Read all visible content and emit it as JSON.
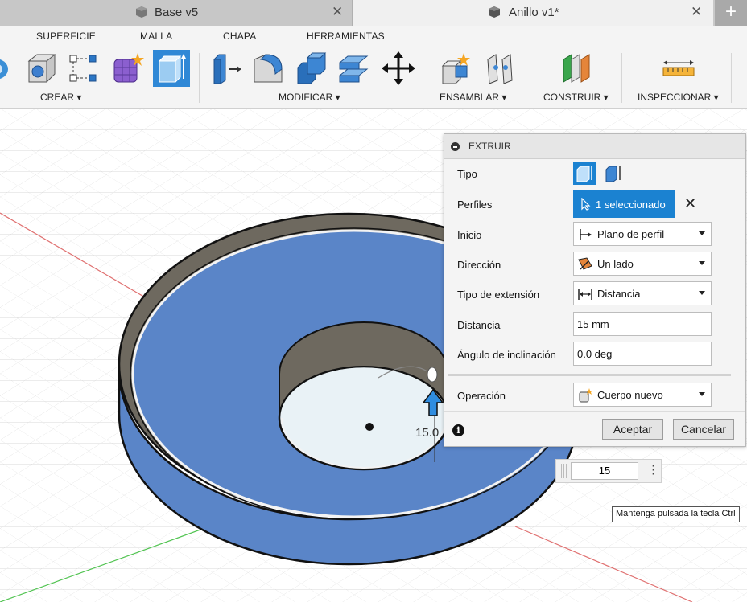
{
  "tabs": [
    {
      "label": "Base v5",
      "icon": "document-cube-icon",
      "active": false
    },
    {
      "label": "Anillo v1*",
      "icon": "document-cube-icon",
      "active": true
    }
  ],
  "toolbar": {
    "subtabs": [
      "SUPERFICIE",
      "MALLA",
      "CHAPA",
      "HERRAMIENTAS"
    ],
    "groups": [
      {
        "label": "CREAR ▾",
        "tools": [
          "revolve-icon",
          "hole-icon",
          "sketch-pattern-icon",
          "form-icon",
          "extrude-icon"
        ]
      },
      {
        "label": "MODIFICAR ▾",
        "tools": [
          "press-pull-icon",
          "fillet-icon",
          "combine-icon",
          "shell-icon",
          "move-icon"
        ]
      },
      {
        "label": "ENSAMBLAR ▾",
        "tools": [
          "new-component-icon",
          "joint-icon"
        ]
      },
      {
        "label": "CONSTRUIR ▾",
        "tools": [
          "offset-plane-icon"
        ]
      },
      {
        "label": "INSPECCIONAR ▾",
        "tools": [
          "measure-icon"
        ]
      }
    ]
  },
  "panel": {
    "title": "EXTRUIR",
    "rows": {
      "tipo": "Tipo",
      "perfiles": "Perfiles",
      "inicio": "Inicio",
      "direccion": "Dirección",
      "tipo_extension": "Tipo de extensión",
      "distancia": "Distancia",
      "angulo": "Ángulo de inclinación",
      "operacion": "Operación"
    },
    "values": {
      "perfiles": "1 seleccionado",
      "inicio": "Plano de perfil",
      "direccion": "Un lado",
      "tipo_extension": "Distancia",
      "distancia": "15 mm",
      "angulo": "0.0 deg",
      "operacion": "Cuerpo nuevo"
    },
    "buttons": {
      "ok": "Aceptar",
      "cancel": "Cancelar"
    },
    "accent": "#1b82d1"
  },
  "viewport": {
    "dimension_value": "15",
    "dimension_label": "15.0",
    "tooltip": "Mantenga pulsada la tecla Ctrl",
    "body_color": "#5a85c8",
    "wall_color": "#6e695f"
  }
}
